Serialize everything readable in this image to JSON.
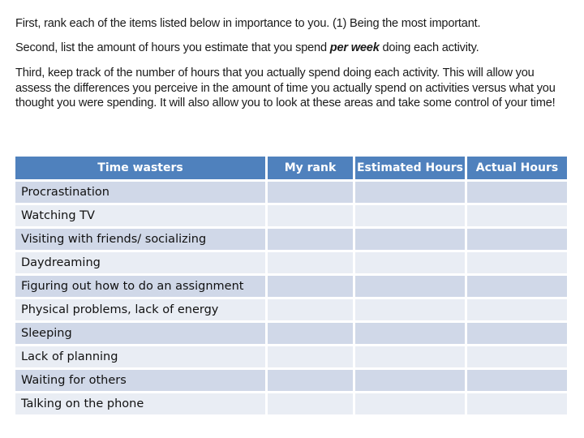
{
  "instructions": {
    "p1": "First, rank each of the items listed below in importance to you.  (1) Being the most important.",
    "p2_before": "Second, list the amount of hours you estimate that you spend ",
    "p2_emphasis": "per week",
    "p2_after": " doing each activity.",
    "p3": "Third, keep track of the number of hours that you actually spend doing each activity.  This will allow you assess the differences you perceive in the amount of time you actually spend on activities versus what you thought you were spending.  It will also allow you to look at these areas and take some control of your time!"
  },
  "table": {
    "header_color": "#4f81bd",
    "row_color_odd": "#d0d8e8",
    "row_color_even": "#e9edf4",
    "columns": [
      "Time wasters",
      "My rank",
      "Estimated Hours",
      "Actual Hours"
    ],
    "rows": [
      {
        "activity": "Procrastination",
        "rank": "",
        "estimated": "",
        "actual": ""
      },
      {
        "activity": "Watching TV",
        "rank": "",
        "estimated": "",
        "actual": ""
      },
      {
        "activity": "Visiting with friends/ socializing",
        "rank": "",
        "estimated": "",
        "actual": ""
      },
      {
        "activity": "Daydreaming",
        "rank": "",
        "estimated": "",
        "actual": ""
      },
      {
        "activity": "Figuring out how to do an assignment",
        "rank": "",
        "estimated": "",
        "actual": ""
      },
      {
        "activity": "Physical problems, lack of energy",
        "rank": "",
        "estimated": "",
        "actual": ""
      },
      {
        "activity": "Sleeping",
        "rank": "",
        "estimated": "",
        "actual": ""
      },
      {
        "activity": "Lack of planning",
        "rank": "",
        "estimated": "",
        "actual": ""
      },
      {
        "activity": "Waiting for others",
        "rank": "",
        "estimated": "",
        "actual": ""
      },
      {
        "activity": "Talking on the phone",
        "rank": "",
        "estimated": "",
        "actual": ""
      }
    ]
  }
}
